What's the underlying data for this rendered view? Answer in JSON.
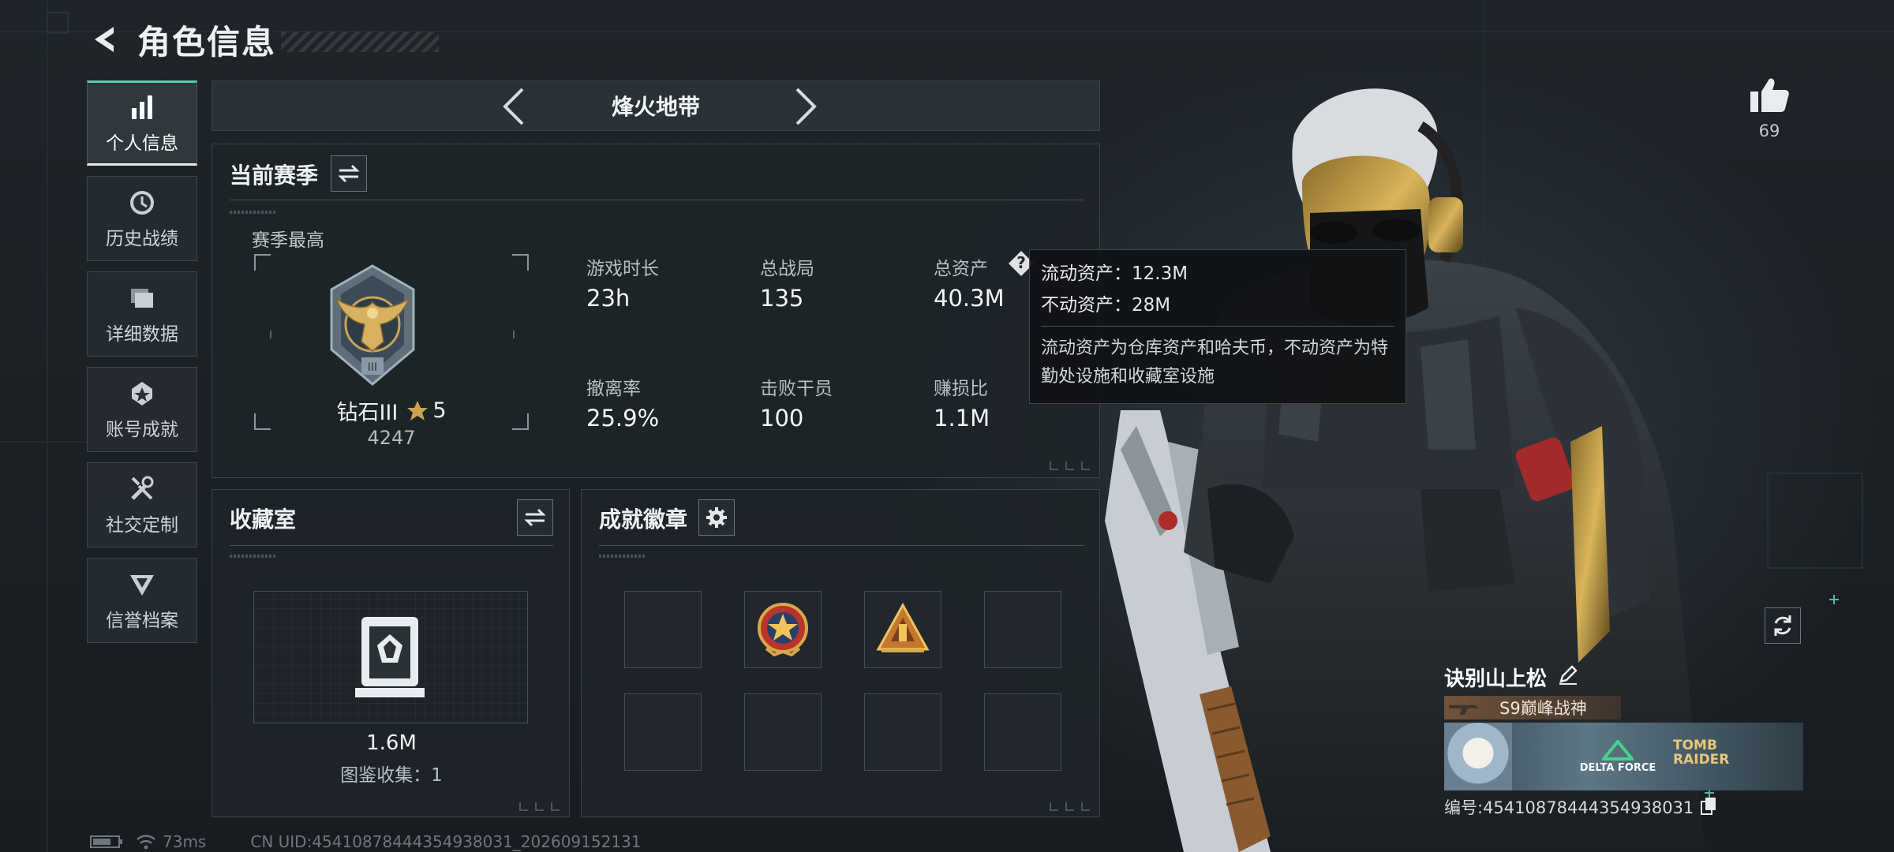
{
  "header": {
    "title": "角色信息"
  },
  "sidebar": {
    "items": [
      {
        "label": "个人信息",
        "icon": "bar-chart-icon",
        "active": true
      },
      {
        "label": "历史战绩",
        "icon": "history-icon",
        "active": false
      },
      {
        "label": "详细数据",
        "icon": "folder-icon",
        "active": false
      },
      {
        "label": "账号成就",
        "icon": "achievement-icon",
        "active": false
      },
      {
        "label": "社交定制",
        "icon": "tools-icon",
        "active": false
      },
      {
        "label": "信誉档案",
        "icon": "reputation-icon",
        "active": false
      }
    ]
  },
  "mode": {
    "title": "烽火地带"
  },
  "season": {
    "title": "当前赛季",
    "best_label": "赛季最高",
    "rank_name": "钻石III",
    "rank_stars": "5",
    "rank_score": "4247",
    "stats": [
      {
        "label": "游戏时长",
        "value": "23h"
      },
      {
        "label": "总战局",
        "value": "135"
      },
      {
        "label": "总资产",
        "value": "40.3M"
      },
      {
        "label": "撤离率",
        "value": "25.9%"
      },
      {
        "label": "击败干员",
        "value": "100"
      },
      {
        "label": "赚损比",
        "value": "1.1M"
      }
    ],
    "help_symbol": "?"
  },
  "tooltip": {
    "liquid": "流动资产：12.3M",
    "fixed": "不动资产：28M",
    "note": "流动资产为仓库资产和哈夫币，不动资产为特勤处设施和收藏室设施"
  },
  "collection": {
    "title": "收藏室",
    "value": "1.6M",
    "count_text": "图鉴收集：1"
  },
  "badges": {
    "title": "成就徽章",
    "slots": [
      "empty",
      "star-badge",
      "triangle-badge",
      "empty",
      "empty",
      "empty",
      "empty",
      "empty"
    ]
  },
  "like": {
    "count": "69"
  },
  "player": {
    "name": "诀别山上松",
    "title_badge": "S9巅峰战神",
    "banner_logo1": "DELTA FORCE",
    "banner_logo2": "TOMB RAIDER",
    "uid_text": "编号:4541087844435493803​1"
  },
  "status": {
    "ping": "73ms",
    "uid": "CN UID:45410878444354938031_202609152131"
  },
  "colors": {
    "accent": "#5fc8a8",
    "panel_bg": "#1e2429",
    "gold": "#c9a253"
  }
}
